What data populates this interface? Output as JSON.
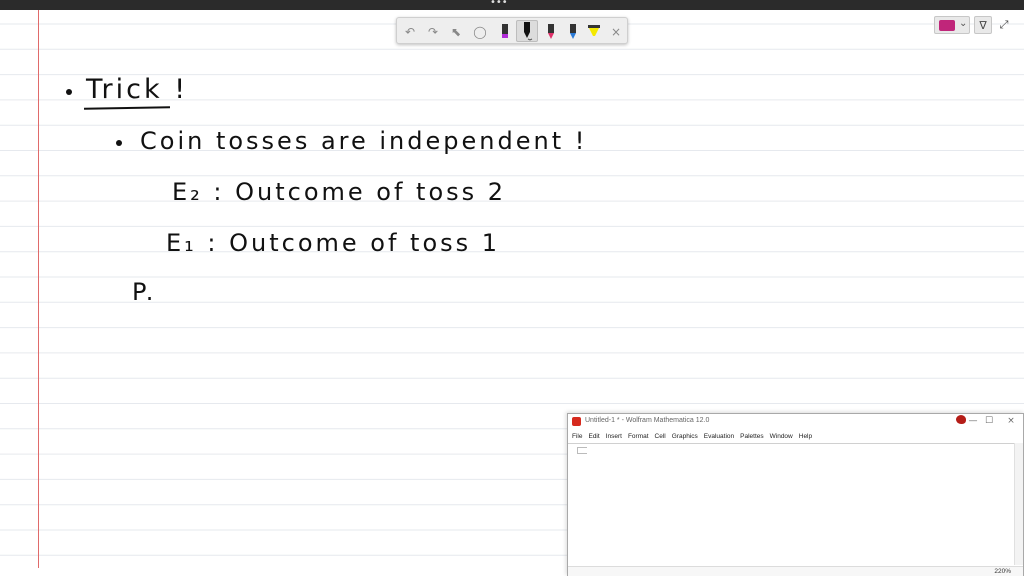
{
  "app": {
    "topbar_dots": "•••"
  },
  "toolbar": {
    "undo_icon": "↶",
    "redo_icon": "↷",
    "select_icon": "⬉",
    "lasso_icon": "◯",
    "pen_colors": [
      "#b12cd8",
      "#111111",
      "#e0306a",
      "#2a7ad6",
      "#f4e900"
    ],
    "close_icon": "×"
  },
  "right_tools": {
    "current_color": "#c0267a",
    "dropdown_icon": "⌄",
    "filter_icon": "∇",
    "expand_icon": "⤢"
  },
  "notes": {
    "trick": "Trick !",
    "line1": "Coin tosses are independent !",
    "line2": "E₂ : Outcome of toss 2",
    "line3": "E₁ : Outcome of toss 1",
    "line4": "P."
  },
  "mathematica": {
    "title": "Untitled-1 * - Wolfram Mathematica 12.0",
    "menu": [
      "File",
      "Edit",
      "Insert",
      "Format",
      "Cell",
      "Graphics",
      "Evaluation",
      "Palettes",
      "Window",
      "Help"
    ],
    "minimize": "—",
    "maximize": "☐",
    "close": "×",
    "zoom": "220%"
  }
}
